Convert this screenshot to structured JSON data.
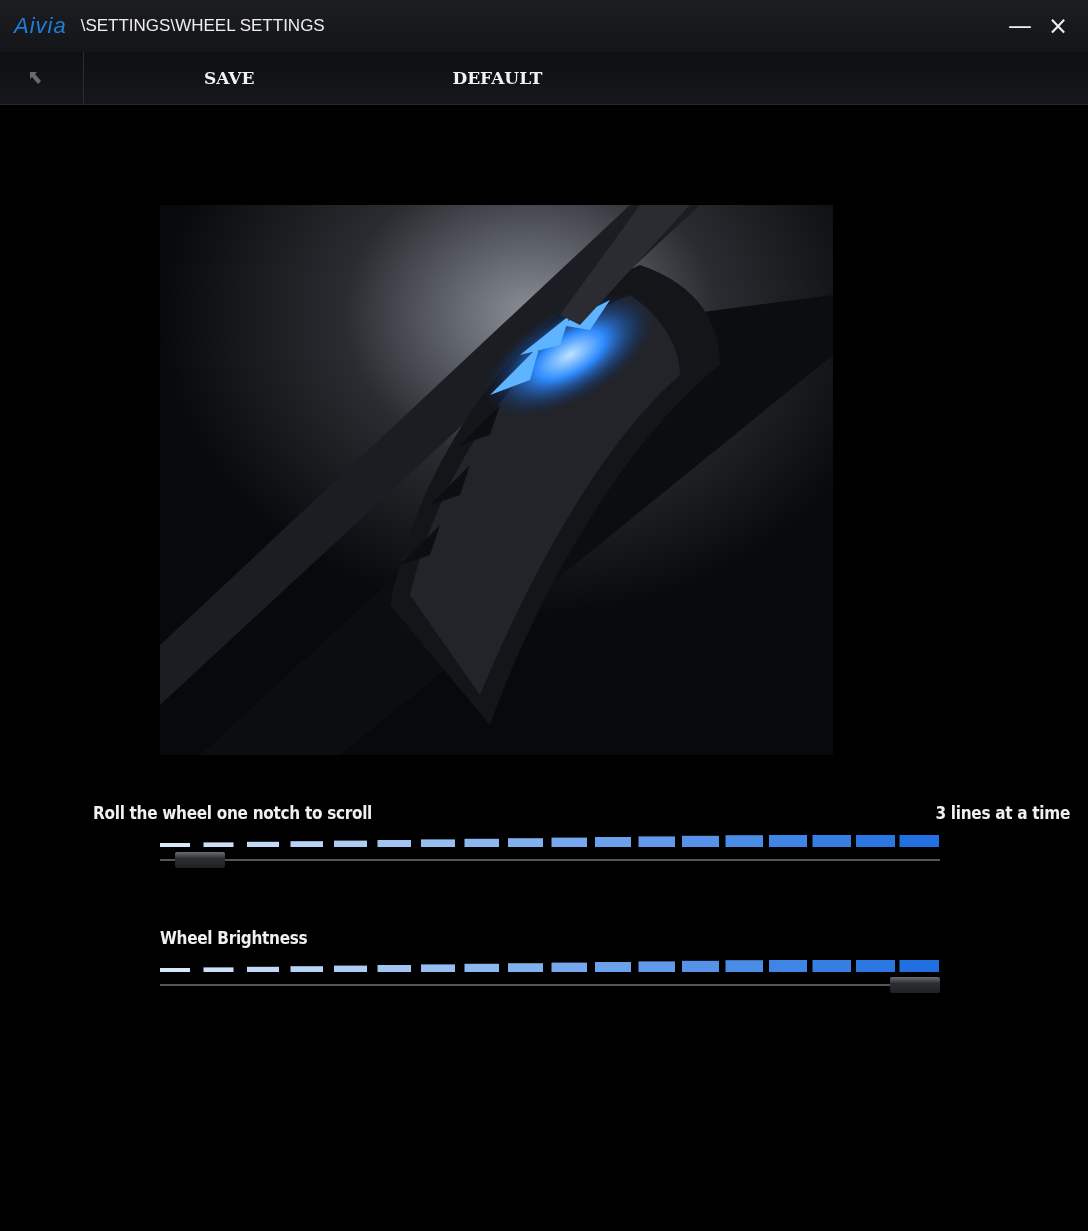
{
  "window": {
    "logo": "Aivia",
    "title": "\\SETTINGS\\WHEEL SETTINGS",
    "minimize": "—",
    "close": "×"
  },
  "toolbar": {
    "buttons": [
      "SAVE",
      "DEFAULT"
    ]
  },
  "sliders": [
    {
      "label": "Roll the wheel one notch to scroll",
      "reading": "3 lines at a time",
      "level": 0.02
    },
    {
      "label": "Wheel Brightness",
      "level": 1
    }
  ]
}
